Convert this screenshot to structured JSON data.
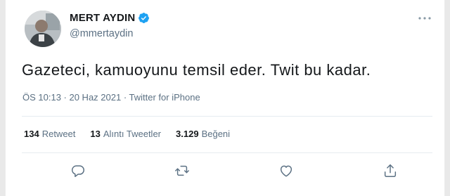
{
  "tweet": {
    "display_name": "MERT AYDIN",
    "handle": "@mmertaydin",
    "verified": true,
    "text": "Gazeteci, kamuoyunu temsil eder. Twit bu kadar.",
    "meta": "ÖS 10:13 · 20 Haz 2021 · Twitter for iPhone"
  },
  "stats": [
    {
      "count": "134",
      "label": "Retweet"
    },
    {
      "count": "13",
      "label": "Alıntı Tweetler"
    },
    {
      "count": "3.129",
      "label": "Beğeni"
    }
  ],
  "actions": [
    "reply-icon",
    "retweet-icon",
    "like-icon",
    "share-icon"
  ],
  "colors": {
    "verified_badge": "#1da1f2",
    "secondary_text": "#5b7083",
    "primary_text": "#14171a",
    "background": "#ffffff"
  }
}
